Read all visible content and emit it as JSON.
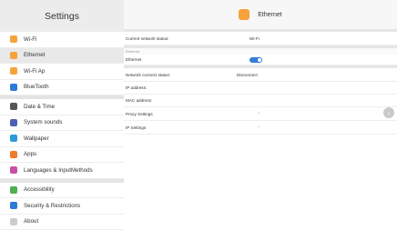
{
  "sidebar": {
    "title": "Settings",
    "groups": [
      [
        {
          "label": "Wi-Fi",
          "icon": "wifi-icon",
          "color": "#f7a23b"
        },
        {
          "label": "Ethernet",
          "icon": "ethernet-icon",
          "color": "#f7a23b",
          "selected": true
        },
        {
          "label": "Wi-Fi Ap",
          "icon": "hotspot-icon",
          "color": "#f7a23b"
        },
        {
          "label": "BlueTooth",
          "icon": "bluetooth-icon",
          "color": "#2b7bd8"
        }
      ],
      [
        {
          "label": "Date & Time",
          "icon": "clock-icon",
          "color": "#555555"
        },
        {
          "label": "System sounds",
          "icon": "speaker-icon",
          "color": "#4f5fb0"
        },
        {
          "label": "Wallpaper",
          "icon": "wallpaper-icon",
          "color": "#2b9bd8"
        },
        {
          "label": "Apps",
          "icon": "apps-icon",
          "color": "#ef7c2c"
        },
        {
          "label": "Languages & InputMethods",
          "icon": "language-icon",
          "color": "#c94fa8"
        }
      ],
      [
        {
          "label": "Accessibility",
          "icon": "accessibility-icon",
          "color": "#4caf50"
        },
        {
          "label": "Security & Restrictions",
          "icon": "security-icon",
          "color": "#2b7bd8"
        },
        {
          "label": "About",
          "icon": "info-icon",
          "color": "#cccccc"
        }
      ]
    ]
  },
  "main": {
    "title": "Ethernet",
    "header_icon": "ethernet-icon",
    "current_status_label": "Current network status:",
    "current_status_value": "Wi-Fi",
    "section_label": "Ethernet",
    "ethernet_toggle_label": "Ethernet",
    "ethernet_toggle_on": true,
    "connect_status_label": "Network connect status:",
    "connect_status_value": "Disconnect",
    "ip_label": "IP address:",
    "mac_label": "MAC address:",
    "proxy_label": "Proxy Settings",
    "ip_settings_label": "IP Settings",
    "chevron": "›"
  },
  "floating_button": {
    "icon": "back-icon",
    "glyph": "‹"
  },
  "colors": {
    "accent": "#2f7fd8",
    "ethernet_icon": "#f7a23b"
  }
}
